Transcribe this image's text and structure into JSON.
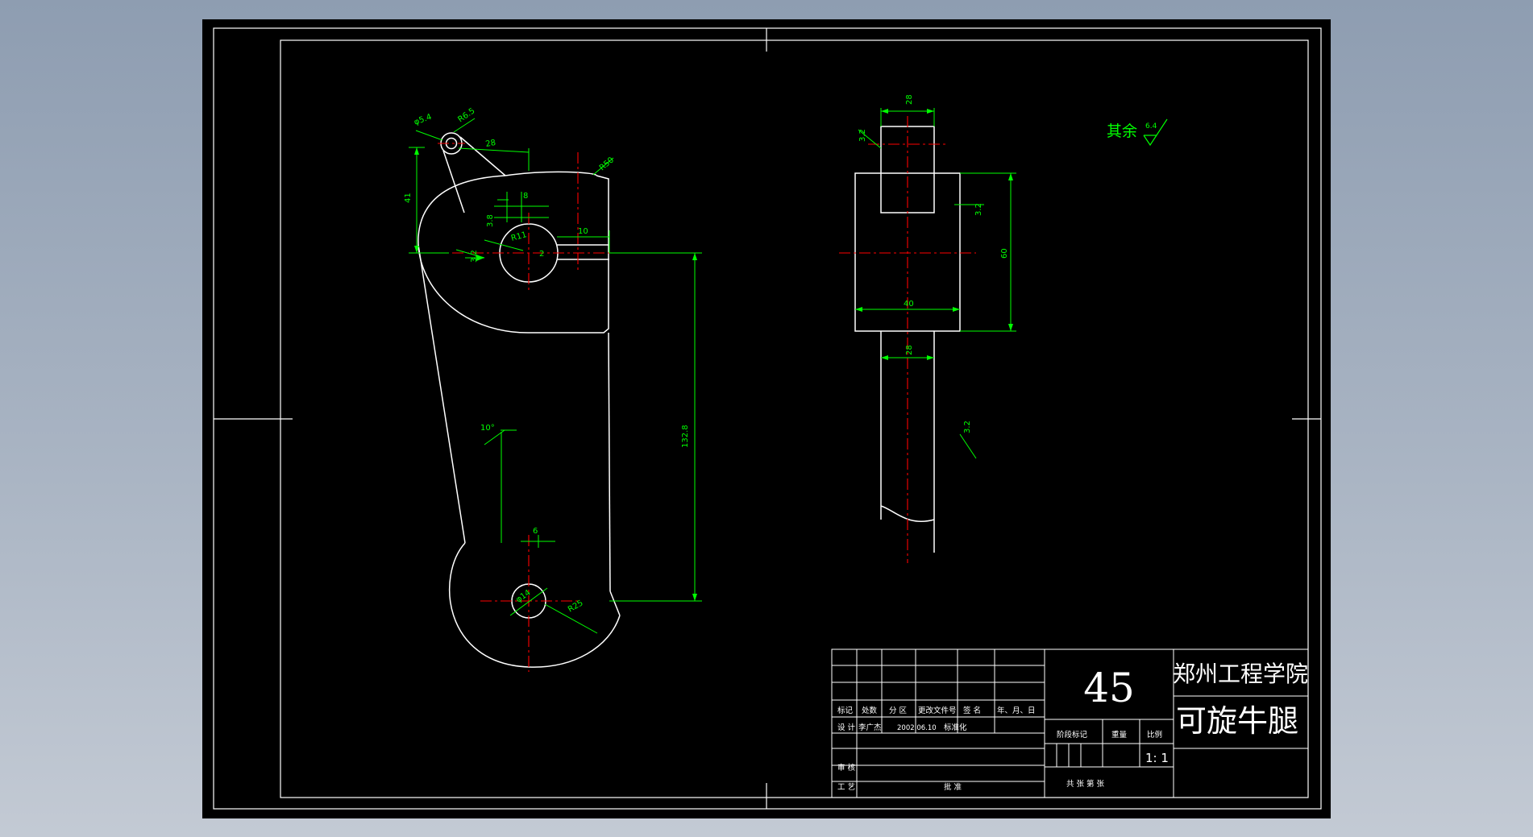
{
  "title_block": {
    "material": "45",
    "school": "郑州工程学院",
    "part_name": "可旋牛腿",
    "headers": {
      "mark": "标记",
      "count": "处数",
      "zone": "分 区",
      "change_doc": "更改文件号",
      "signature": "签 名",
      "date": "年、月、日",
      "design": "设 计",
      "designer": "李广杰",
      "design_date": "2002.06.10",
      "standardization": "标准化",
      "stage_mark": "阶段标记",
      "weight": "重量",
      "scale_label": "比例",
      "scale": "1: 1",
      "review": "审 核",
      "process": "工 艺",
      "approve": "批 准",
      "sheets": "共   张   第   张"
    }
  },
  "notes": {
    "other_surfaces": "其余",
    "other_roughness": "6.4"
  },
  "dimensions": {
    "small_hole_dia": "φ5.4",
    "small_hole_r": "R6.5",
    "d28_top_left": "28",
    "d41": "41",
    "r50": "R50",
    "d8": "8",
    "d3_8": "3.8",
    "r11": "R11",
    "d10": "10",
    "d2": "2",
    "rough_3_2_left": "3.2",
    "d132_8": "132.8",
    "angle_10": "10°",
    "d6": "6",
    "big_hole_dia": "φ14",
    "r25": "R25",
    "side_28_top": "28",
    "side_rough_top": "3.2",
    "side_rough_right": "3.2",
    "side_60": "60",
    "side_40": "40",
    "side_28_bottom": "28",
    "side_rough_shaft": "3.2"
  },
  "colors": {
    "background": "#000000",
    "outline": "#ffffff",
    "dimension": "#00ff00",
    "centerline": "#ff0000",
    "title_text": "#ffffff"
  }
}
